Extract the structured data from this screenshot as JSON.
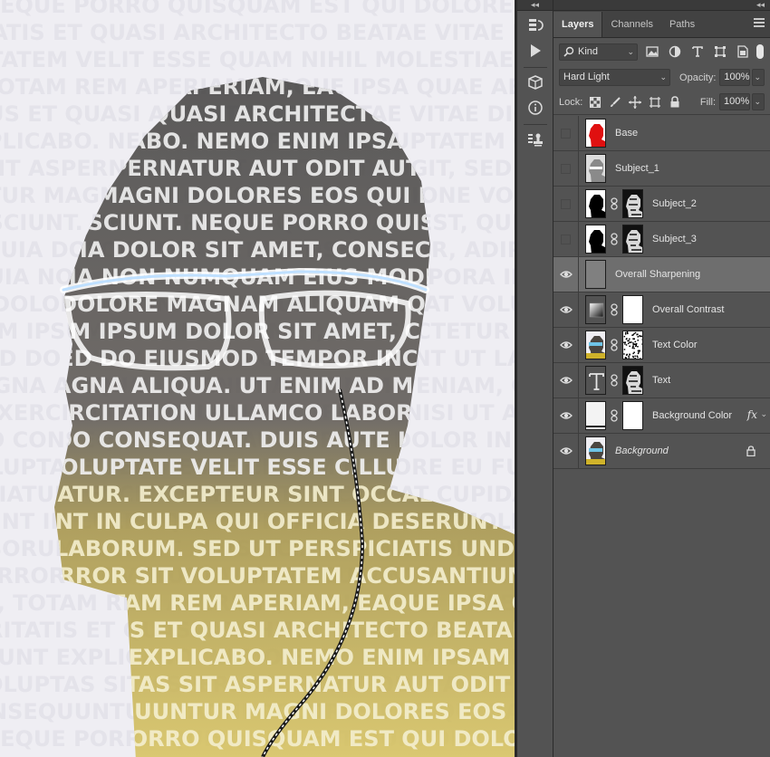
{
  "panel": {
    "tabs": [
      "Layers",
      "Channels",
      "Paths"
    ],
    "filter": {
      "label": "Kind",
      "icon": "search-icon"
    },
    "blend_mode": "Hard Light",
    "opacity_label": "Opacity:",
    "opacity_value": "100%",
    "lock_label": "Lock:",
    "fill_label": "Fill:",
    "fill_value": "100%"
  },
  "layers": [
    {
      "name": "Base",
      "visible": false,
      "selected": false,
      "thumb": "red-silhouette",
      "mask": null,
      "italic": false
    },
    {
      "name": "Subject_1",
      "visible": false,
      "selected": false,
      "thumb": "gray-portrait",
      "mask": null,
      "italic": false
    },
    {
      "name": "Subject_2",
      "visible": false,
      "selected": false,
      "thumb": "black-silhouette",
      "mask": "bw-portrait",
      "italic": false
    },
    {
      "name": "Subject_3",
      "visible": false,
      "selected": false,
      "thumb": "black-silhouette",
      "mask": "bw-portrait",
      "italic": false
    },
    {
      "name": "Overall Sharpening",
      "visible": true,
      "selected": true,
      "thumb": "gray-fill",
      "mask": null,
      "italic": false
    },
    {
      "name": "Overall Contrast",
      "visible": true,
      "selected": false,
      "thumb": "adjustment-icon",
      "mask": "white",
      "italic": false
    },
    {
      "name": "Text Color",
      "visible": true,
      "selected": false,
      "thumb": "color-portrait",
      "mask": "speckle",
      "italic": false
    },
    {
      "name": "Text",
      "visible": true,
      "selected": false,
      "thumb": "type-icon",
      "mask": "bw-portrait",
      "italic": false
    },
    {
      "name": "Background Color",
      "visible": true,
      "selected": false,
      "thumb": "white-fill",
      "mask": "white",
      "italic": false,
      "fx": "fx"
    },
    {
      "name": "Background",
      "visible": true,
      "selected": false,
      "thumb": "color-portrait",
      "mask": null,
      "italic": true,
      "locked": true
    }
  ],
  "canvas_text": [
    "NEQUE PORRO QUISQUAM EST QUI DOLOREM IPSUM QUIA DOLOR SIT AMET CONSECTETUR ADIPISCI",
    "TIATIS ET QUASI ARCHITECTO BEATAE VITAE DICTA SUNT EXPLICABO NEMO ENIM IPSAM",
    "UPTATEM VELIT ESSE QUAM NIHIL MOLESTIAE CONSEQUATUR VEL ILLUM QUI DOLOREM EUM",
    "TOTAM REM APERIAM, EAQUE IPSA QUAE AB ILLO INVENTORE VERITATIS ET QUASI",
    "NUS ET QUASI ARCHITECTO BEATAE VITAE DICTA SUNT EXPLICABO NEMO ENIM",
    "EXPLICABO. NEMO ENIM IPSAM VOLUPTATEM QUIA VOLUPTAS SIT ASPERNATUR",
    "SIT ASPERNATUR AUT ODIT AUT FUGIT, SED QUIA CONSEQUUNTUR MAGNI",
    "NTUR MAGNI DOLORES EOS QUI RATIONE VOLUPTATEM SEQUI NESCIUNT",
    "NESCIUNT. NEQUE PORRO QUISQUAM EST, QUI DOLOREM IPSUM",
    "QUIA DOLOR SIT AMET, CONSECTETUR, ADIPISCI VELIT, SED QUIA NON",
    "QUIA NON NUMQUAM EIUS MODI TEMPORA INCIDUNT UT LABORE",
    "ET DOLORE MAGNAM ALIQUAM QUAERAT VOLUPTATEM UT ENIM",
    "EM IPSUM DOLOR SIT AMET, CONSECTETUR ADIPISCING ELIT",
    "SED DO EIUSMOD TEMPOR INCIDIDUNT UT LABORE ET DOLORE",
    "MAGNA ALIQUA. UT ENIM AD MINIM VENIAM, QUIS NOSTRUD",
    "EXERCITATION ULLAMCO LABORIS NISI UT ALIQUIP EX EA",
    "DO CONSEQUAT. DUIS AUTE IRURE DOLOR IN REPREHENDERIT",
    "VOLUPTATE VELIT ESSE CILLUM DOLORE EU FUGIAT NULLA",
    "RIATUR. EXCEPTEUR SINT OCCAECAT CUPIDATAT NON PROIDENT",
    "SUNT IN CULPA QUI OFFICIA DESERUNT MOLLIT ANIM ID",
    "LABORUM. SED UT PERSPICIATIS UNDE OMNIS ISTE NATUS",
    "ERROR SIT VOLUPTATEM ACCUSANTIUM DOLOREMQUE LAUDANTIUM",
    "EL, TOTAM REM APERIAM, EAQUE IPSA QUAE AB ILLO",
    "VERITATIS ET QUASI ARCHITECTO BEATAE VITAE DICTA",
    "SUNT EXPLICABO. NEMO ENIM IPSAM VOLUPTATEM QUIA",
    "VOLUPTAS SIT ASPERNATUR AUT ODIT AUT FUGIT, SED QUIA",
    "CONSEQUUNTUR MAGNI DOLORES EOS QUI RATIONE VOLUPTATEM"
  ]
}
